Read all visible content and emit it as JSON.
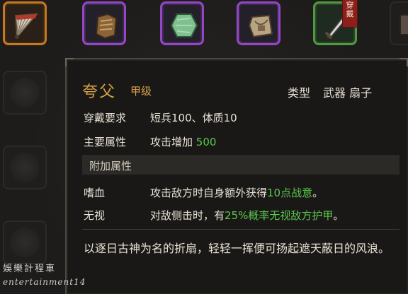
{
  "equipment_slots": [
    {
      "name": "fan-icon",
      "rarity": "orange"
    },
    {
      "name": "armor-icon",
      "rarity": "purple"
    },
    {
      "name": "jade-icon",
      "rarity": "purple"
    },
    {
      "name": "pouch-icon",
      "rarity": "purple"
    },
    {
      "name": "sword-icon",
      "rarity": "green",
      "badge": "穿戴"
    }
  ],
  "tooltip": {
    "name": "夸父",
    "grade": "甲级",
    "type_label": "类型",
    "type_value": "武器 扇子",
    "requirement_label": "穿戴要求",
    "requirement_value": "短兵100、体质10",
    "main_attr_label": "主要属性",
    "main_attr_text": "攻击增加 ",
    "main_attr_value": "500",
    "extra_section": "附加属性",
    "extra": [
      {
        "label": "嗜血",
        "pre": "攻击敌方时自身额外获得",
        "highlight": "10点战意",
        "post": "。"
      },
      {
        "label": "无视",
        "pre": "对敌侧击时，有",
        "highlight": "25%概率无视敌方护甲",
        "post": "。"
      }
    ],
    "description": "以逐日古神为名的折扇，轻轻一挥便可扬起遮天蔽日的风浪。"
  },
  "watermark": {
    "cn": "娛樂計程車",
    "en": "entertainment14"
  },
  "colors": {
    "accent_gold": "#d6a048",
    "highlight_green": "#58c84e",
    "rare_orange": "#c8781e",
    "epic_purple": "#9446c6",
    "uncommon_green": "#4e9a40"
  }
}
